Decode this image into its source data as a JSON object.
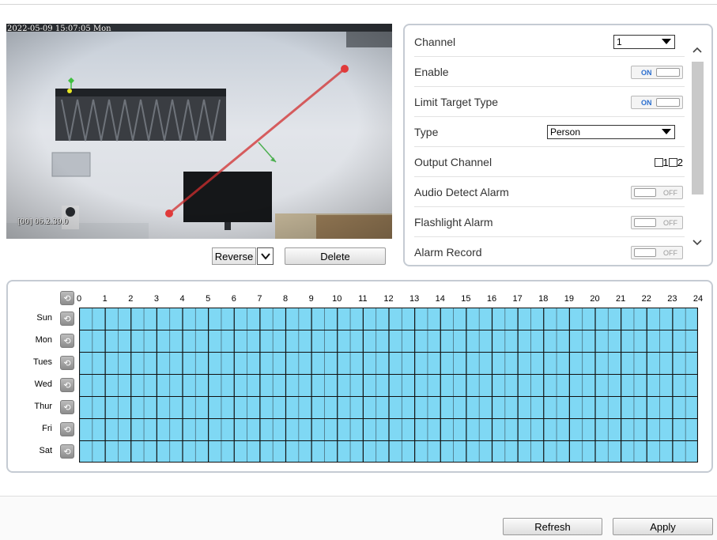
{
  "video": {
    "timestamp": "2022-05-09 15:07:05 Mon",
    "camera_osd": "[00] 06.2.39.0",
    "reverse_label": "Reverse",
    "delete_label": "Delete"
  },
  "settings": {
    "channel": {
      "label": "Channel",
      "value": "1"
    },
    "enable": {
      "label": "Enable",
      "state": "ON"
    },
    "limit_target_type": {
      "label": "Limit Target Type",
      "state": "ON"
    },
    "type": {
      "label": "Type",
      "value": "Person"
    },
    "output_channel": {
      "label": "Output Channel",
      "opt1": "1",
      "opt2": "2"
    },
    "audio_detect_alarm": {
      "label": "Audio Detect Alarm",
      "state": "OFF"
    },
    "flashlight_alarm": {
      "label": "Flashlight Alarm",
      "state": "OFF"
    },
    "alarm_record": {
      "label": "Alarm Record",
      "state": "OFF"
    }
  },
  "schedule": {
    "hours": [
      "0",
      "1",
      "2",
      "3",
      "4",
      "5",
      "6",
      "7",
      "8",
      "9",
      "10",
      "11",
      "12",
      "13",
      "14",
      "15",
      "16",
      "17",
      "18",
      "19",
      "20",
      "21",
      "22",
      "23",
      "24"
    ],
    "days": [
      "Sun",
      "Mon",
      "Tues",
      "Wed",
      "Thur",
      "Fri",
      "Sat"
    ],
    "fill_color": "#7fd8f4"
  },
  "footer": {
    "refresh_label": "Refresh",
    "apply_label": "Apply"
  },
  "icons": {
    "schedule_toggle": "swap-circle-icon",
    "dropdown": "chevron-down-icon",
    "scroll_up": "chevron-up-icon",
    "scroll_down": "chevron-down-icon"
  }
}
